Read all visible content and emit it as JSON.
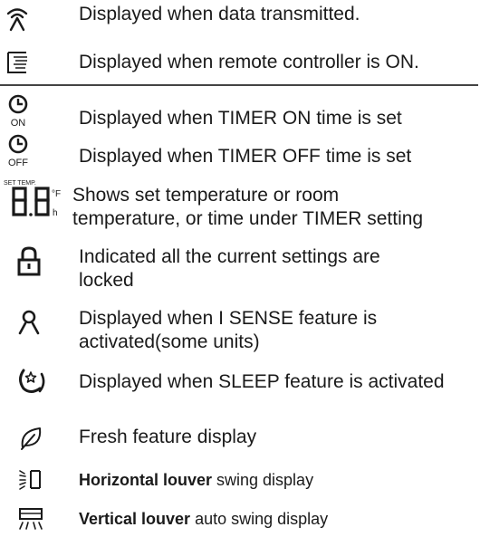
{
  "items": [
    {
      "icon": "transmit-signal-icon",
      "text": "Displayed when data transmitted."
    },
    {
      "icon": "remote-on-icon",
      "text": "Displayed when remote controller is ON."
    },
    {
      "icon": "timer-on-icon",
      "icon_label": "ON",
      "text": "Displayed when TIMER ON time is set"
    },
    {
      "icon": "timer-off-icon",
      "icon_label": "OFF",
      "text": "Displayed when TIMER OFF time is set"
    },
    {
      "icon": "temperature-digits-icon",
      "icon_label": "SET TEMP.",
      "unit_top": "°F",
      "unit_bottom": "h",
      "text_line1": "Shows set temperature or room",
      "text_line2": "temperature, or time under TIMER setting"
    },
    {
      "icon": "lock-icon",
      "text_line1": "Indicated all the current settings are",
      "text_line2": "locked"
    },
    {
      "icon": "person-sense-icon",
      "text_line1": "Displayed when I SENSE feature is",
      "text_line2": "activated(some units)"
    },
    {
      "icon": "sleep-icon",
      "text": "Displayed when SLEEP feature is activated"
    },
    {
      "icon": "leaf-icon",
      "text": "Fresh feature display"
    },
    {
      "icon": "horizontal-louver-icon",
      "bold": "Horizontal louver",
      "text": " swing display"
    },
    {
      "icon": "vertical-louver-icon",
      "bold": "Vertical louver",
      "text": " auto swing display"
    }
  ]
}
